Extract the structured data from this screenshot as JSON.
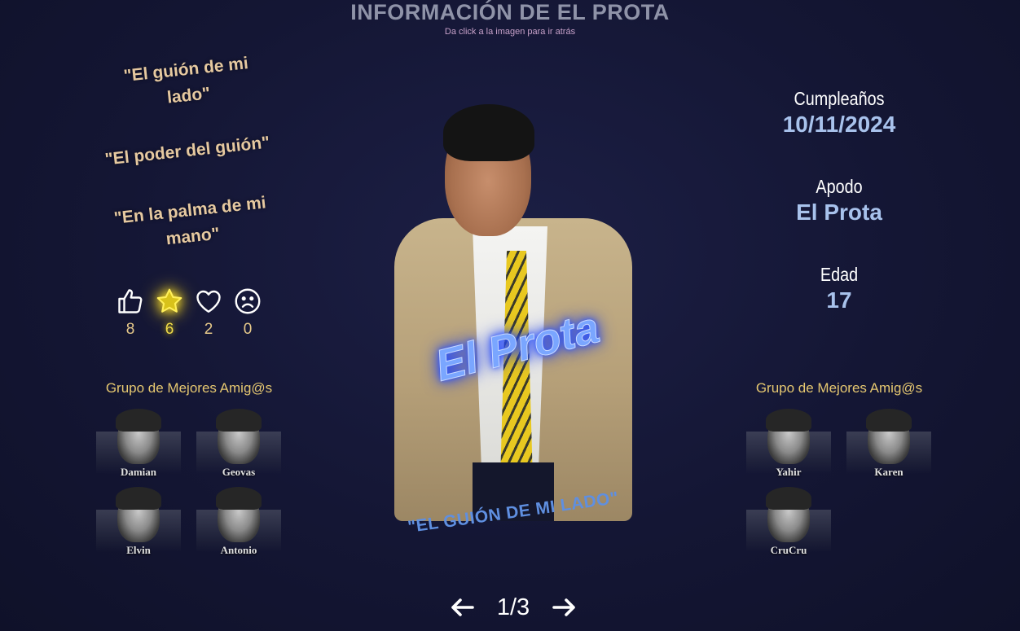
{
  "header": {
    "title": "INFORMACIÓN DE EL PROTA",
    "subtitle": "Da click a la imagen para ir atrás"
  },
  "quotes": [
    "\"El guión de mi lado\"",
    "\"El poder del guión\"",
    "\"En la palma de mi mano\""
  ],
  "reactions": [
    {
      "icon": "thumbs-up-icon",
      "count": "8"
    },
    {
      "icon": "star-icon",
      "count": "6",
      "active": true
    },
    {
      "icon": "heart-icon",
      "count": "2"
    },
    {
      "icon": "sad-face-icon",
      "count": "0"
    }
  ],
  "friends_left": {
    "title": "Grupo de Mejores Amig@s",
    "members": [
      "Damian",
      "Geovas",
      "Elvin",
      "Antonio"
    ]
  },
  "friends_right": {
    "title": "Grupo de Mejores Amig@s",
    "members": [
      "Yahir",
      "Karen",
      "CruCru"
    ]
  },
  "photo": {
    "name": "El Prota",
    "quote": "\"EL GUIÓN DE MI LADO\""
  },
  "info": {
    "birthday_label": "Cumpleaños",
    "birthday_value": "10/11/2024",
    "nickname_label": "Apodo",
    "nickname_value": "El Prota",
    "age_label": "Edad",
    "age_value": "17"
  },
  "pager": {
    "current": "1/3",
    "prev_icon": "arrow-left-icon",
    "next_icon": "arrow-right-icon"
  },
  "colors": {
    "background": "#141634",
    "quote": "#e6c9a0",
    "gold": "#e5c770",
    "info_value": "#a8c2ec",
    "name_glow": "#2448ff"
  }
}
